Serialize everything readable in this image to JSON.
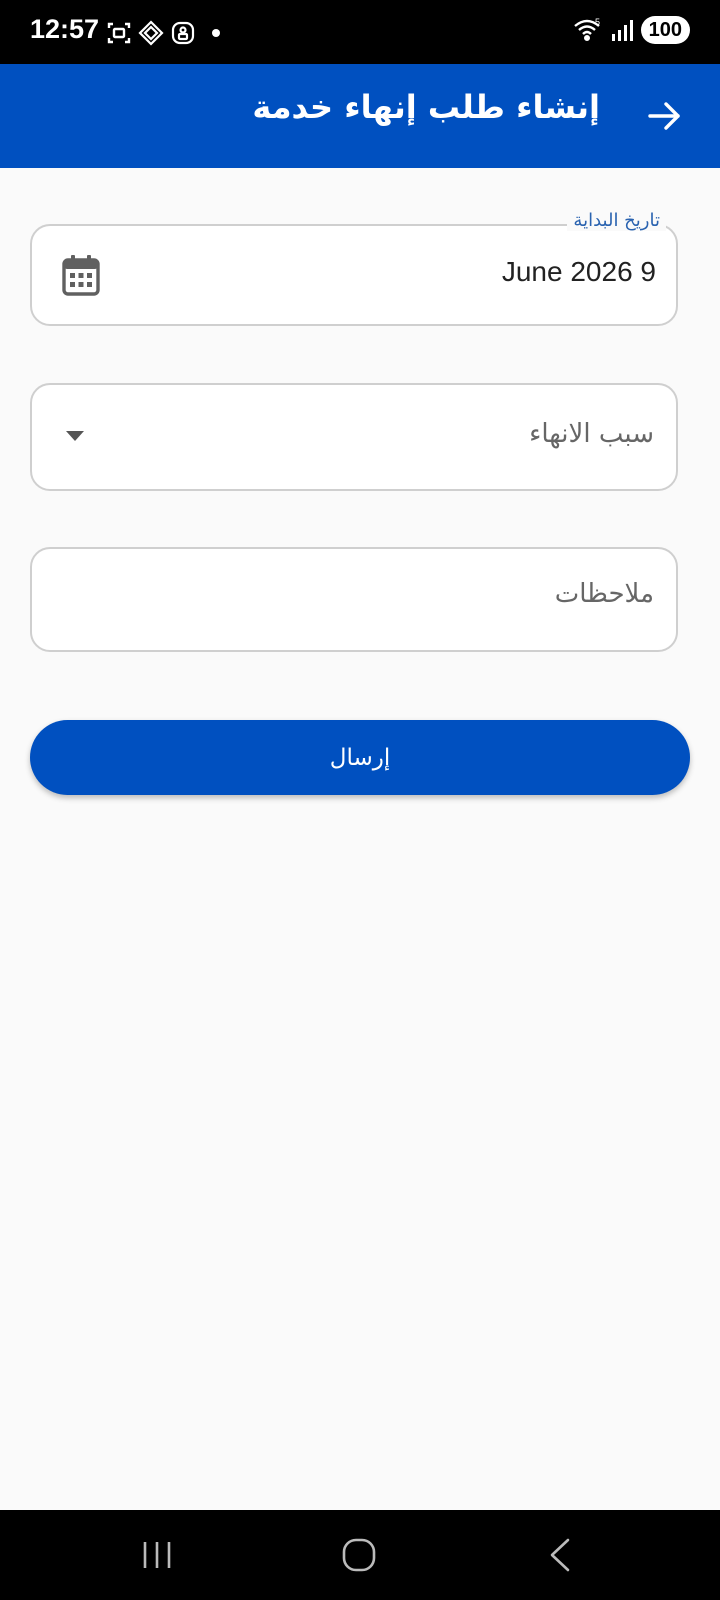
{
  "status_bar": {
    "time": "12:57",
    "battery": "100",
    "network_label": "5"
  },
  "app_bar": {
    "title": "إنشاء طلب إنهاء خدمة",
    "color": "#0050c0"
  },
  "form": {
    "start_date": {
      "label": "تاريخ البداية",
      "value": "June 2026 9"
    },
    "termination_reason": {
      "placeholder": "سبب الانهاء"
    },
    "notes": {
      "placeholder": "ملاحظات"
    },
    "submit_label": "إرسال"
  }
}
